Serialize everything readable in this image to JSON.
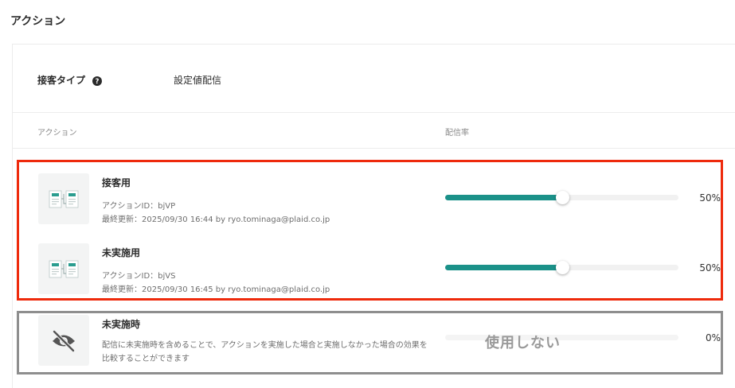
{
  "page": {
    "title": "アクション"
  },
  "delivery_type": {
    "label": "接客タイプ",
    "value": "設定値配信"
  },
  "table_header": {
    "action": "アクション",
    "rate": "配信率"
  },
  "actions": [
    {
      "name": "接客用",
      "action_id": "アクションID：bjVP",
      "updated": "最終更新：2025/09/30 16:44 by ryo.tominaga@plaid.co.jp",
      "rate": 50,
      "rate_label": "50%"
    },
    {
      "name": "未実施用",
      "action_id": "アクションID：bjVS",
      "updated": "最終更新：2025/09/30 16:45 by ryo.tominaga@plaid.co.jp",
      "rate": 50,
      "rate_label": "50%"
    }
  ],
  "control": {
    "name": "未実施時",
    "description": "配信に未実施時を含めることで、アクションを実施した場合と実施しなかった場合の効果を比較することができます",
    "status": "使用しない",
    "rate": 0,
    "rate_label": "0%",
    "icon": "eye-off-icon"
  },
  "colors": {
    "slider_fill": "#1b9189",
    "highlight_active": "#ee2a0c",
    "highlight_control": "#8e8e8e"
  }
}
